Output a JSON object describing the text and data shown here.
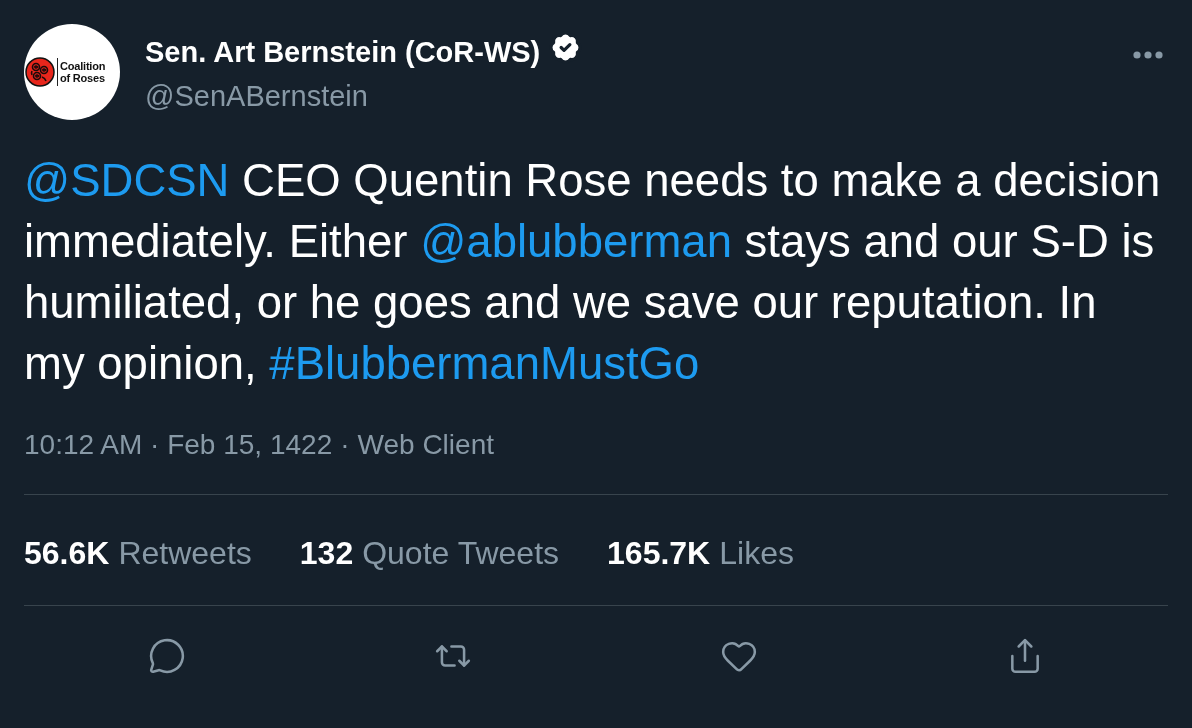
{
  "tweet": {
    "author": {
      "logo_lines": [
        "Coalition",
        "of Roses"
      ],
      "name": "Sen. Art Bernstein (CoR-WS)",
      "verified": true,
      "handle": "@SenABernstein"
    },
    "text": [
      {
        "kind": "mention",
        "text": "@SDCSN"
      },
      {
        "kind": "text",
        "text": " CEO Quentin Rose needs to make a decision immediately. Either "
      },
      {
        "kind": "mention",
        "text": "@ablubberman"
      },
      {
        "kind": "text",
        "text": " stays and our S-D is humiliated, or he goes and we save our reputation. In my opinion, "
      },
      {
        "kind": "hashtag",
        "text": "#BlubbermanMustGo"
      }
    ],
    "timestamp": "10:12 AM · Feb 15, 1422",
    "separator": "·",
    "source": "Web Client",
    "stats": [
      {
        "count": "56.6K",
        "label": "Retweets"
      },
      {
        "count": "132",
        "label": "Quote Tweets"
      },
      {
        "count": "165.7K",
        "label": "Likes"
      }
    ],
    "actions": [
      {
        "kind": "reply"
      },
      {
        "kind": "retweet"
      },
      {
        "kind": "like"
      },
      {
        "kind": "share"
      }
    ]
  }
}
